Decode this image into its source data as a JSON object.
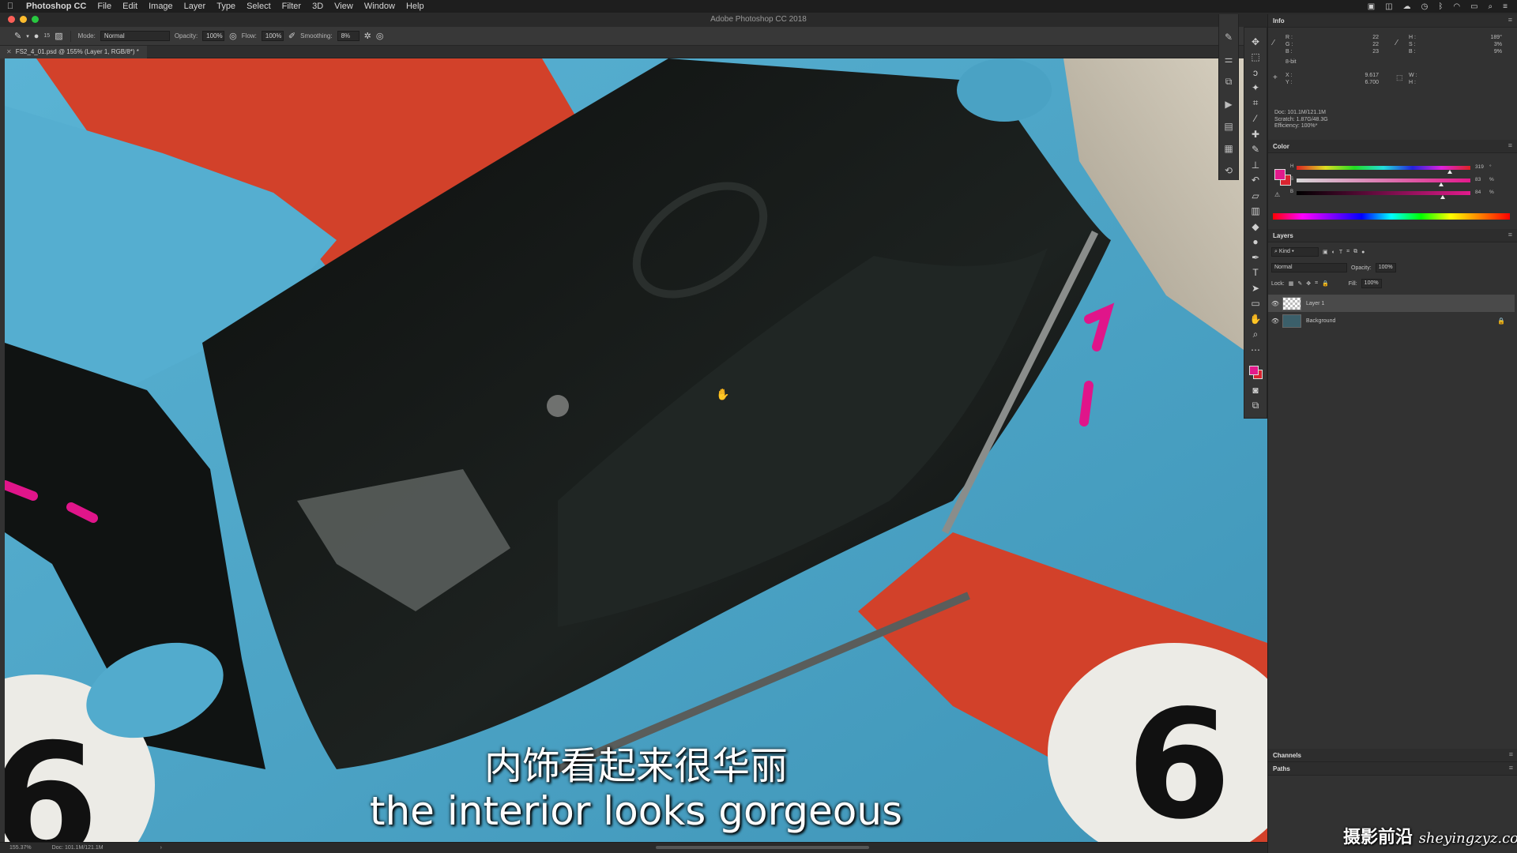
{
  "menubar": {
    "app_name": "Photoshop CC",
    "items": [
      "File",
      "Edit",
      "Image",
      "Layer",
      "Type",
      "Select",
      "Filter",
      "3D",
      "View",
      "Window",
      "Help"
    ]
  },
  "window": {
    "title": "Adobe Photoshop CC 2018"
  },
  "options": {
    "mode_label": "Mode:",
    "mode_value": "Normal",
    "opacity_label": "Opacity:",
    "opacity_value": "100%",
    "flow_label": "Flow:",
    "flow_value": "100%",
    "smoothing_label": "Smoothing:",
    "smoothing_value": "8%",
    "brush_size": "15"
  },
  "document": {
    "tab_title": "FS2_4_01.psd @ 155% (Layer 1, RGB/8*) *"
  },
  "status": {
    "zoom": "155.37%",
    "doc": "Doc: 101.1M/121.1M"
  },
  "subtitles": {
    "chinese": "内饰看起来很华丽",
    "english": "the interior looks gorgeous"
  },
  "watermark": {
    "cn": "摄影前沿",
    "url": "sheyingzyz.com"
  },
  "info_panel": {
    "title": "Info",
    "rgb_labels": [
      "R :",
      "G :",
      "B :"
    ],
    "rgb_values": [
      "22",
      "22",
      "23"
    ],
    "hsb_labels": [
      "H :",
      "S :",
      "B :"
    ],
    "hsb_values": [
      "189°",
      "3%",
      "9%"
    ],
    "bit_depth": "8-bit",
    "xy_labels": [
      "X :",
      "Y :"
    ],
    "xy_values": [
      "9.617",
      "6.700"
    ],
    "wh_labels": [
      "W :",
      "H :"
    ],
    "doc_line": "Doc: 101.1M/121.1M",
    "scratch_line": "Scratch: 1.87G/48.3G",
    "efficiency_line": "Efficiency: 100%*"
  },
  "color_panel": {
    "title": "Color",
    "sliders": [
      {
        "label": "H",
        "value": "319",
        "unit": "°",
        "position": 0.88
      },
      {
        "label": "S",
        "value": "83",
        "unit": "%",
        "position": 0.83
      },
      {
        "label": "B",
        "value": "84",
        "unit": "%",
        "position": 0.84
      }
    ],
    "foreground": "#e21a8c",
    "background": "#d9232f"
  },
  "layers_panel": {
    "title": "Layers",
    "filter_kind": "Kind",
    "blend_mode": "Normal",
    "opacity_label": "Opacity:",
    "opacity_value": "100%",
    "lock_label": "Lock:",
    "fill_label": "Fill:",
    "fill_value": "100%",
    "layers": [
      {
        "name": "Layer 1",
        "active": true
      },
      {
        "name": "Background",
        "active": false,
        "locked": true
      }
    ]
  },
  "channels_panel": {
    "title": "Channels"
  },
  "paths_panel": {
    "title": "Paths"
  },
  "colors": {
    "car_blue": "#4aa7c9",
    "car_orange": "#d2412a",
    "brush_magenta": "#e0158a",
    "glass": "#141716"
  }
}
